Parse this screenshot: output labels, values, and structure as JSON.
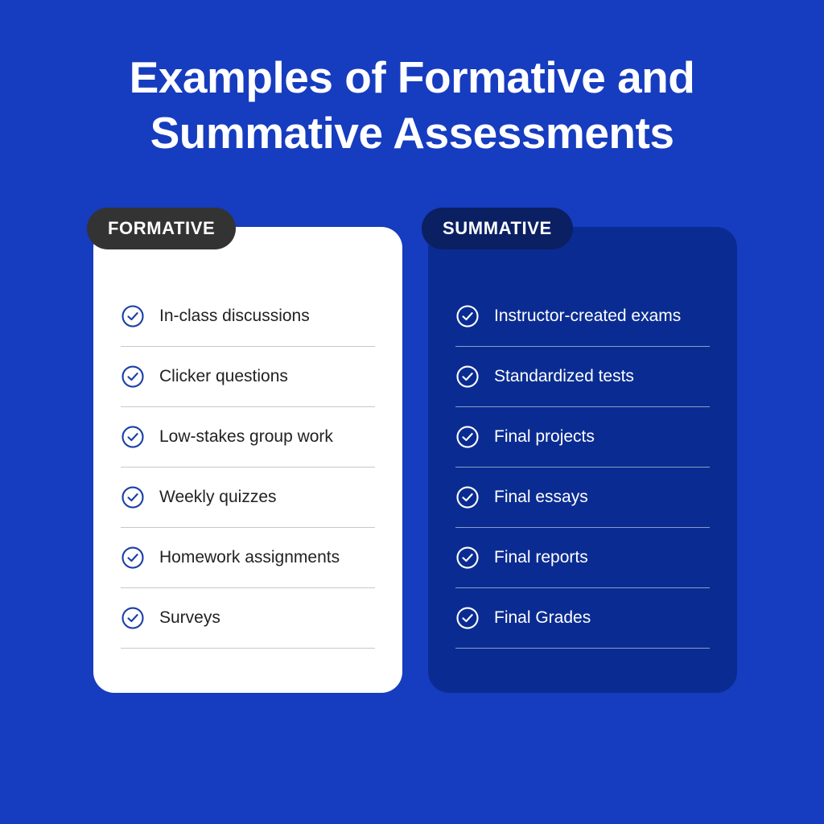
{
  "title": {
    "line1": "Examples of Formative and",
    "line2": "Summative Assessments"
  },
  "colors": {
    "background": "#163CBF",
    "formative_card": "#FFFFFF",
    "summative_card": "#0A2C92",
    "formative_pill": "#333333",
    "summative_pill": "#0B2063",
    "formative_text": "#222222",
    "summative_text": "#FFFFFF",
    "formative_icon": "#1B3FA8",
    "summative_icon": "#FFFFFF",
    "formative_divider": "#C8C8C8",
    "summative_divider": "#8C9BC6"
  },
  "columns": [
    {
      "id": "formative",
      "tab_label": "FORMATIVE",
      "icon_name": "check-circle-icon",
      "items": [
        "In-class discussions",
        "Clicker questions",
        "Low-stakes group work",
        "Weekly quizzes",
        "Homework assignments",
        "Surveys"
      ]
    },
    {
      "id": "summative",
      "tab_label": "SUMMATIVE",
      "icon_name": "check-circle-icon",
      "items": [
        "Instructor-created exams",
        "Standardized tests",
        "Final projects",
        "Final essays",
        "Final reports",
        "Final Grades"
      ]
    }
  ]
}
